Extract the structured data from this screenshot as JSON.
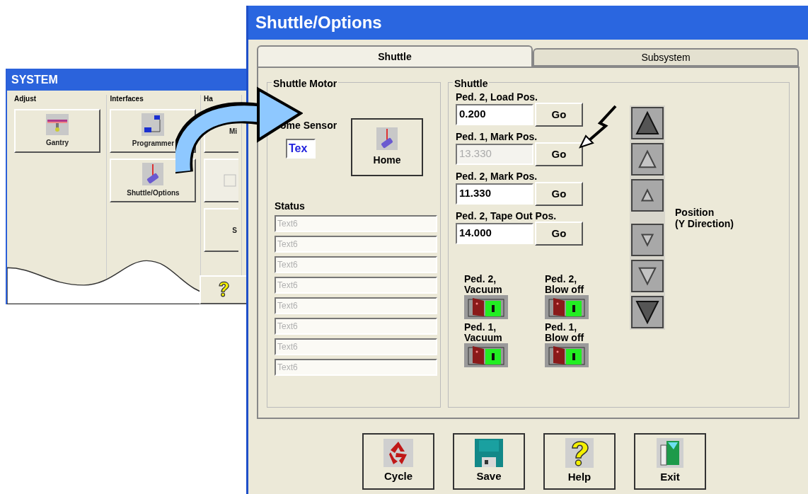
{
  "system_window": {
    "title": "SYSTEM",
    "groups": [
      {
        "label": "Adjust",
        "buttons": [
          {
            "label": "Gantry",
            "kind": "gantry"
          }
        ]
      },
      {
        "label": "Interfaces",
        "buttons": [
          {
            "label": "Programmer",
            "kind": "programmer"
          },
          {
            "label": "Shuttle/Options",
            "kind": "shuttle"
          }
        ]
      },
      {
        "label": "Ha",
        "buttons": [
          {
            "label": "Mi",
            "kind": "plain"
          },
          {
            "kind": "blank",
            "disabled": true
          },
          {
            "label": "S",
            "kind": "plain"
          }
        ]
      }
    ]
  },
  "main_window": {
    "title": "Shuttle/Options",
    "tabs": [
      {
        "label": "Shuttle",
        "selected": true
      },
      {
        "label": "Subsystem",
        "selected": false
      }
    ],
    "shuttle_motor": {
      "label": "Shuttle Motor",
      "home_sensor_label": "ome Sensor",
      "home_sensor_value": "Tex",
      "home_button": "Home",
      "status_label": "Status",
      "status_fields": [
        "Text6",
        "Text6",
        "Text6",
        "Text6",
        "Text6",
        "Text6",
        "Text6",
        "Text6"
      ]
    },
    "shuttle": {
      "label": "Shuttle",
      "positions": [
        {
          "label": "Ped. 2, Load Pos.",
          "value": "0.200",
          "disabled": false,
          "button": "Go"
        },
        {
          "label": "Ped. 1, Mark Pos.",
          "value": "13.330",
          "disabled": true,
          "button": "Go"
        },
        {
          "label": "Ped. 2, Mark Pos.",
          "value": "11.330",
          "disabled": false,
          "button": "Go"
        },
        {
          "label": "Ped. 2, Tape Out Pos.",
          "value": "14.000",
          "disabled": false,
          "button": "Go"
        }
      ],
      "valves": [
        {
          "lines": [
            "Ped. 2,",
            "Vacuum"
          ]
        },
        {
          "lines": [
            "Ped. 2,",
            "Blow off"
          ]
        },
        {
          "lines": [
            "Ped. 1,",
            "Vacuum"
          ]
        },
        {
          "lines": [
            "Ped. 1,",
            "Blow off"
          ]
        }
      ],
      "jog_buttons": [
        {
          "kind": "up-large"
        },
        {
          "kind": "up-medium"
        },
        {
          "kind": "up-small"
        },
        {
          "kind": "down-small"
        },
        {
          "kind": "down-medium"
        },
        {
          "kind": "down-large"
        }
      ],
      "jog_label": [
        "Position",
        "(Y Direction)"
      ]
    },
    "footer_buttons": [
      {
        "label": "Cycle",
        "kind": "recycle"
      },
      {
        "label": "Save",
        "kind": "disk"
      },
      {
        "label": "Help",
        "kind": "help"
      },
      {
        "label": "Exit",
        "kind": "exit"
      }
    ]
  }
}
